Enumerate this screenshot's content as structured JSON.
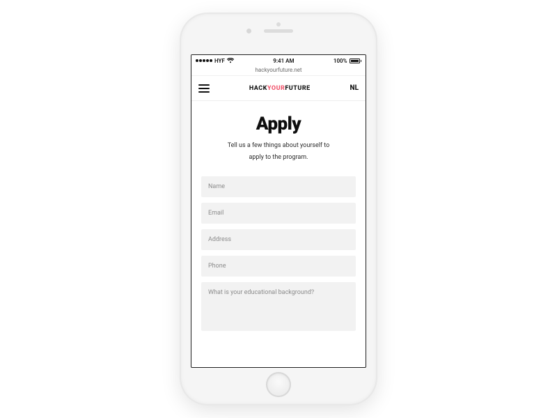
{
  "status": {
    "carrier": "HYF",
    "time": "9:41 AM",
    "battery_pct": "100%"
  },
  "browser": {
    "url": "hackyourfuture.net"
  },
  "header": {
    "brand_part1": "HACK",
    "brand_accent": "YOUR",
    "brand_part2": "FUTURE",
    "lang_toggle": "NL"
  },
  "page": {
    "title": "Apply",
    "subtitle_l1": "Tell us a few things about yourself to",
    "subtitle_l2": "apply to the program."
  },
  "form": {
    "name_placeholder": "Name",
    "email_placeholder": "Email",
    "address_placeholder": "Address",
    "phone_placeholder": "Phone",
    "education_placeholder": "What is your educational background?"
  }
}
